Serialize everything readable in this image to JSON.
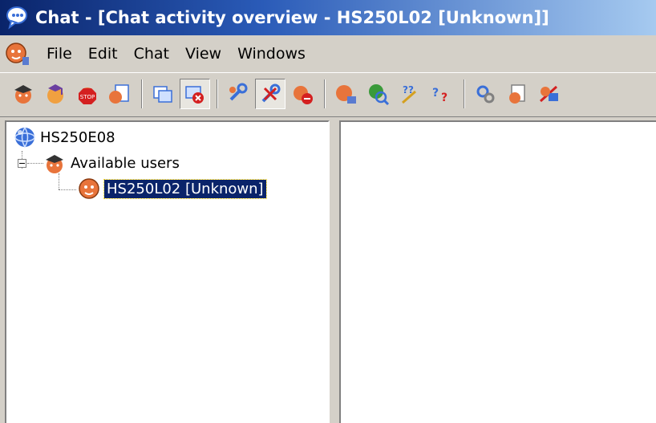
{
  "window": {
    "title": "Chat - [Chat activity overview - HS250L02 [Unknown]]",
    "app_icon": "chat-bubble-icon"
  },
  "menubar": {
    "doc_icon": "user-face-icon",
    "items": [
      {
        "label": "File"
      },
      {
        "label": "Edit"
      },
      {
        "label": "Chat"
      },
      {
        "label": "View"
      },
      {
        "label": "Windows"
      }
    ]
  },
  "toolbar": {
    "buttons": [
      {
        "icon": "users-hat-icon"
      },
      {
        "icon": "user-graduate-icon"
      },
      {
        "icon": "stop-user-icon"
      },
      {
        "icon": "user-clipboard-icon"
      },
      {
        "icon": "copy-message-icon"
      },
      {
        "icon": "delete-message-icon",
        "pressed": true
      },
      {
        "icon": "tools-icon"
      },
      {
        "icon": "cross-tools-icon",
        "pressed": true
      },
      {
        "icon": "no-entry-user-icon"
      },
      {
        "icon": "user-mail-icon"
      },
      {
        "icon": "user-search-icon"
      },
      {
        "icon": "help-arrow-icon"
      },
      {
        "icon": "help-icon"
      },
      {
        "icon": "settings-icon"
      },
      {
        "icon": "document-user-icon"
      },
      {
        "icon": "disconnect-icon"
      }
    ],
    "colors": {
      "face": "#e8743b",
      "red": "#d42020",
      "blue": "#3a6fd8",
      "green": "#3a9a3a"
    }
  },
  "tree": {
    "root": {
      "label": "HS250E08",
      "icon": "network-globe-icon"
    },
    "group": {
      "label": "Available users",
      "icon": "users-hat-icon",
      "expanded": true
    },
    "user": {
      "label": "HS250L02 [Unknown]",
      "icon": "user-face-icon",
      "selected": true
    }
  },
  "colors": {
    "titlebar_start": "#0a246a",
    "titlebar_end": "#a6caf0",
    "chrome": "#d4d0c8",
    "selection": "#0a246a"
  }
}
